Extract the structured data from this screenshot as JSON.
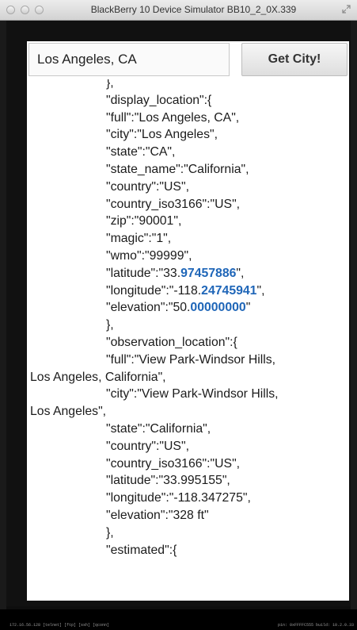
{
  "window": {
    "title": "BlackBerry 10 Device Simulator BB10_2_0X.339"
  },
  "app": {
    "search": {
      "value": "Los Angeles, CA"
    },
    "get_city_label": "Get City!"
  },
  "json_lines": [
    {
      "pre": "},",
      "hl": "",
      "post": "",
      "cont": false
    },
    {
      "pre": "\"display_location\":{",
      "hl": "",
      "post": "",
      "cont": false
    },
    {
      "pre": "\"full\":\"Los Angeles, CA\",",
      "hl": "",
      "post": "",
      "cont": false
    },
    {
      "pre": "\"city\":\"Los Angeles\",",
      "hl": "",
      "post": "",
      "cont": false
    },
    {
      "pre": "\"state\":\"CA\",",
      "hl": "",
      "post": "",
      "cont": false
    },
    {
      "pre": "\"state_name\":\"California\",",
      "hl": "",
      "post": "",
      "cont": false
    },
    {
      "pre": "\"country\":\"US\",",
      "hl": "",
      "post": "",
      "cont": false
    },
    {
      "pre": "\"country_iso3166\":\"US\",",
      "hl": "",
      "post": "",
      "cont": false
    },
    {
      "pre": "\"zip\":\"90001\",",
      "hl": "",
      "post": "",
      "cont": false
    },
    {
      "pre": "\"magic\":\"1\",",
      "hl": "",
      "post": "",
      "cont": false
    },
    {
      "pre": "\"wmo\":\"99999\",",
      "hl": "",
      "post": "",
      "cont": false
    },
    {
      "pre": "\"latitude\":\"33.",
      "hl": "97457886",
      "post": "\",",
      "cont": false
    },
    {
      "pre": "\"longitude\":\"-118.",
      "hl": "24745941",
      "post": "\",",
      "cont": false
    },
    {
      "pre": "\"elevation\":\"50.",
      "hl": "00000000",
      "post": "\"",
      "cont": false
    },
    {
      "pre": "},",
      "hl": "",
      "post": "",
      "cont": false
    },
    {
      "pre": "\"observation_location\":{",
      "hl": "",
      "post": "",
      "cont": false
    },
    {
      "pre": "\"full\":\"View Park-Windsor Hills,",
      "hl": "",
      "post": "",
      "cont": false
    },
    {
      "pre": "Los Angeles, California\",",
      "hl": "",
      "post": "",
      "cont": true
    },
    {
      "pre": "\"city\":\"View Park-Windsor Hills,",
      "hl": "",
      "post": "",
      "cont": false
    },
    {
      "pre": "Los Angeles\",",
      "hl": "",
      "post": "",
      "cont": true
    },
    {
      "pre": "\"state\":\"California\",",
      "hl": "",
      "post": "",
      "cont": false
    },
    {
      "pre": "\"country\":\"US\",",
      "hl": "",
      "post": "",
      "cont": false
    },
    {
      "pre": "\"country_iso3166\":\"US\",",
      "hl": "",
      "post": "",
      "cont": false
    },
    {
      "pre": "\"latitude\":\"33.995155\",",
      "hl": "",
      "post": "",
      "cont": false
    },
    {
      "pre": "\"longitude\":\"-118.347275\",",
      "hl": "",
      "post": "",
      "cont": false
    },
    {
      "pre": "\"elevation\":\"328 ft\"",
      "hl": "",
      "post": "",
      "cont": false
    },
    {
      "pre": "},",
      "hl": "",
      "post": "",
      "cont": false
    },
    {
      "pre": "\"estimated\":{",
      "hl": "",
      "post": "",
      "cont": false
    }
  ],
  "status": {
    "left": "172.16.56.128      [telnet]  [ftp]  [ssh]  [qconn]",
    "right": "pin: 0xFFFFC555    build: 10.2.0.33"
  },
  "colors": {
    "highlight_number": "#1f66b8",
    "screen_background": "#111111"
  }
}
